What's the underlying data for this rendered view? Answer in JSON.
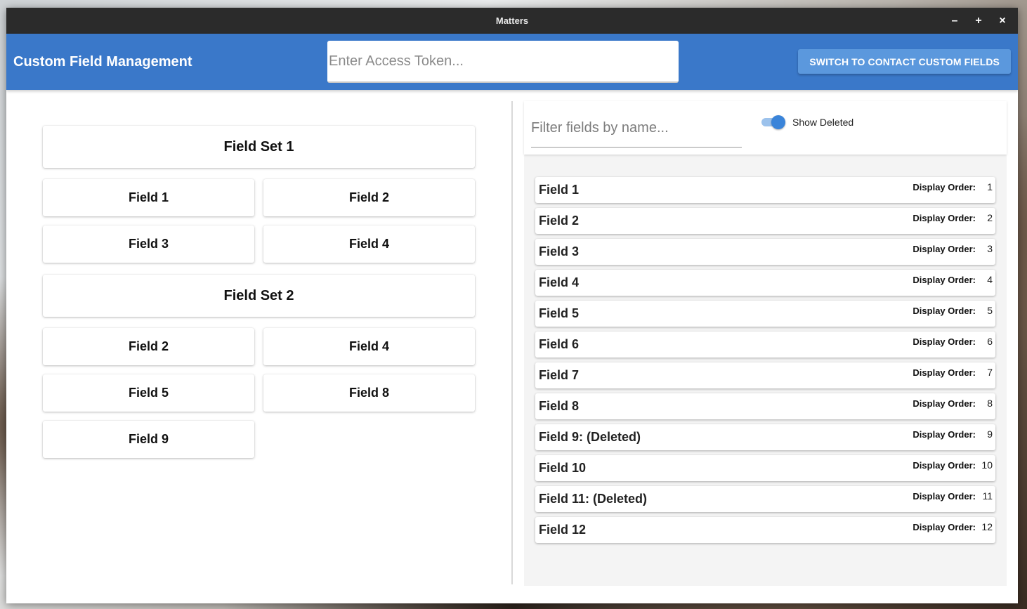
{
  "window": {
    "title": "Matters",
    "controls": {
      "minimize": "–",
      "maximize": "+",
      "close": "×"
    }
  },
  "appbar": {
    "heading": "Custom Field Management",
    "token_placeholder": "Enter Access Token...",
    "switch_button": "SWITCH TO CONTACT CUSTOM FIELDS"
  },
  "field_sets": [
    {
      "title": "Field Set 1",
      "fields": [
        "Field 1",
        "Field 2",
        "Field 3",
        "Field 4"
      ]
    },
    {
      "title": "Field Set 2",
      "fields": [
        "Field 2",
        "Field 4",
        "Field 5",
        "Field 8",
        "Field 9"
      ]
    }
  ],
  "filter": {
    "placeholder": "Filter fields by name...",
    "show_deleted_label": "Show Deleted",
    "show_deleted": true
  },
  "field_list": {
    "order_label": "Display Order:",
    "items": [
      {
        "name": "Field 1",
        "order": "1"
      },
      {
        "name": "Field 2",
        "order": "2"
      },
      {
        "name": "Field 3",
        "order": "3"
      },
      {
        "name": "Field 4",
        "order": "4"
      },
      {
        "name": "Field 5",
        "order": "5"
      },
      {
        "name": "Field 6",
        "order": "6"
      },
      {
        "name": "Field 7",
        "order": "7"
      },
      {
        "name": "Field 8",
        "order": "8"
      },
      {
        "name": "Field 9: (Deleted)",
        "order": "9"
      },
      {
        "name": "Field 10",
        "order": "10"
      },
      {
        "name": "Field 11: (Deleted)",
        "order": "11"
      },
      {
        "name": "Field 12",
        "order": "12"
      }
    ]
  },
  "colors": {
    "appbar": "#3a78c9",
    "button": "#5b98dd",
    "titlebar": "#2b2b2b",
    "toggle_accent": "#3a84d9"
  },
  "icons": {
    "minimize": "minimize-icon",
    "maximize": "maximize-icon",
    "close": "close-icon"
  }
}
